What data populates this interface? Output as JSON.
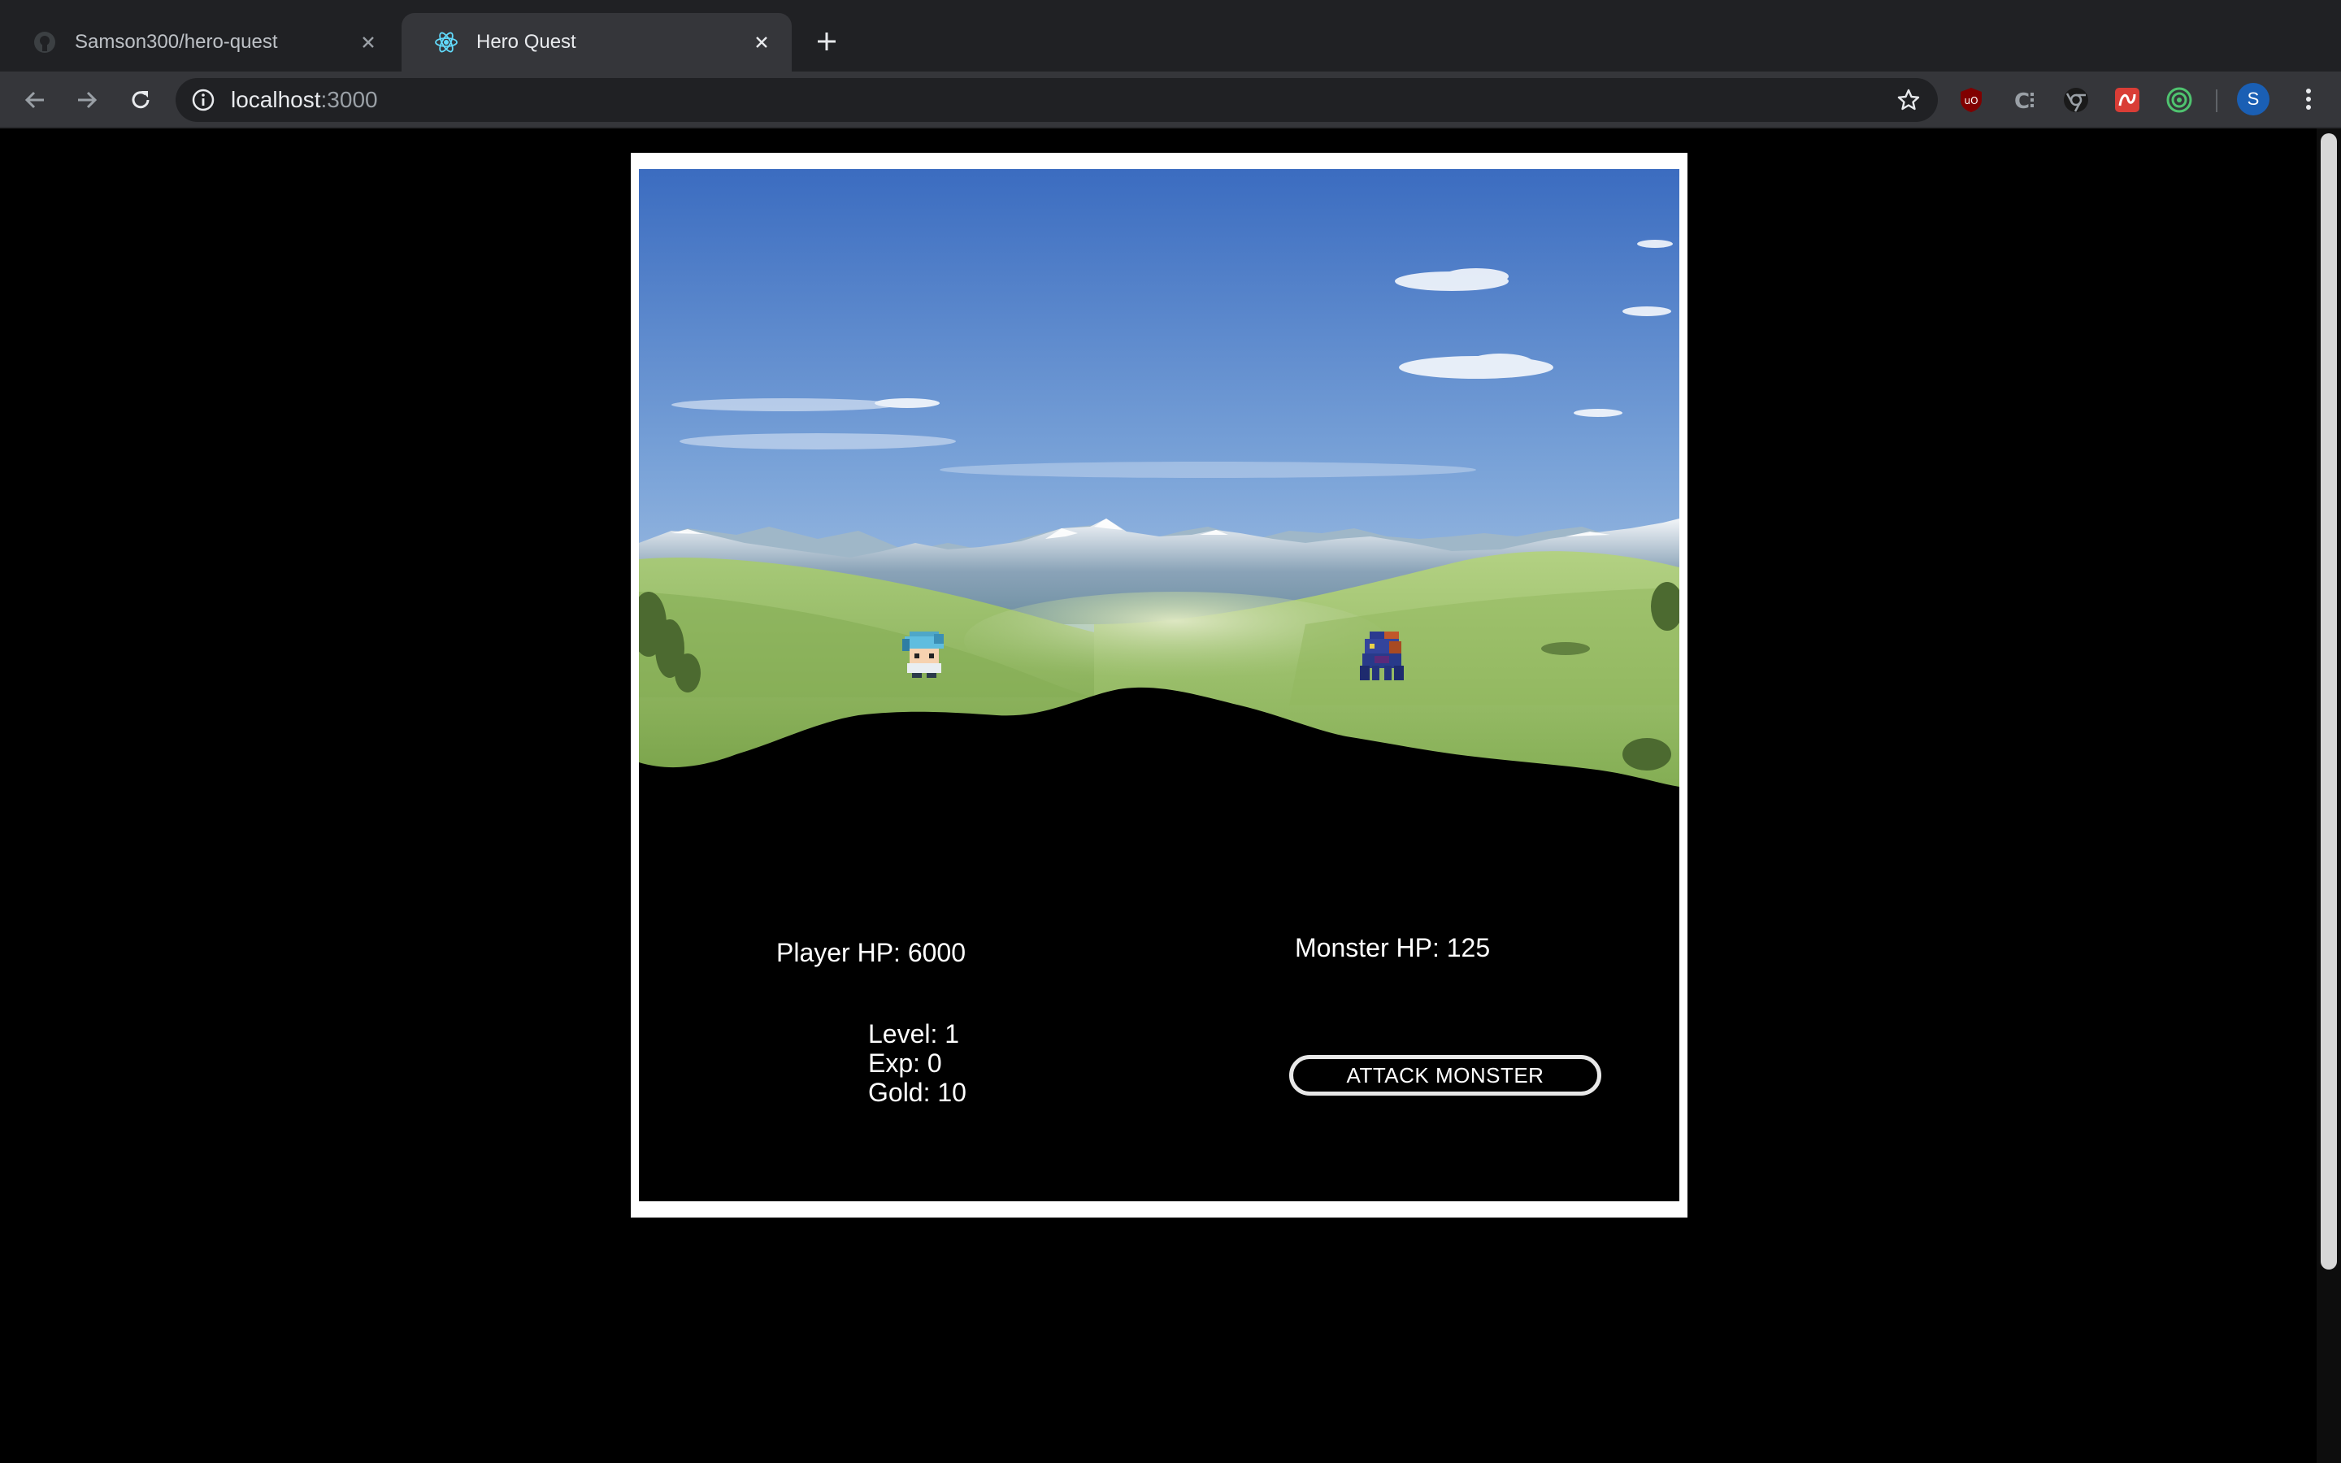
{
  "browser": {
    "tabs": [
      {
        "title": "Samson300/hero-quest",
        "favicon": "github-icon",
        "active": false
      },
      {
        "title": "Hero Quest",
        "favicon": "react-icon",
        "active": true
      }
    ],
    "url_host": "localhost",
    "url_port": ":3000",
    "profile_initial": "S",
    "extensions": [
      "ublock-origin-icon",
      "clearbit-connect-icon",
      "chromatic-icon",
      "graffiti-app-icon",
      "target-ring-icon"
    ]
  },
  "game": {
    "player_hp_label": "Player HP: 6000",
    "monster_hp_label": "Monster HP: 125",
    "level_label": "Level: 1",
    "exp_label": "Exp: 0",
    "gold_label": "Gold: 10",
    "attack_button_label": "ATTACK MONSTER"
  },
  "colors": {
    "tab_strip": "#202124",
    "toolbar": "#35363a",
    "page_background": "#000000",
    "frame_border": "#ffffff",
    "sky_top": "#3f6fc2",
    "grass": "#8bbd55"
  }
}
